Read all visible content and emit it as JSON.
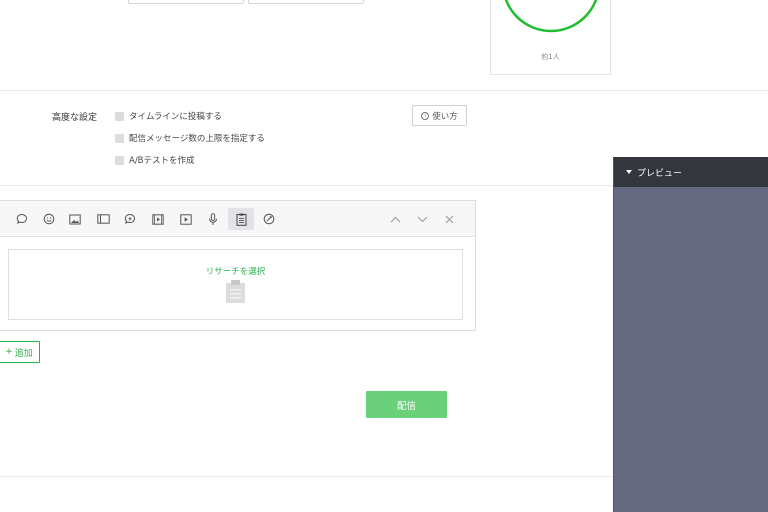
{
  "audience": {
    "percent_value": "100",
    "percent_unit": "%",
    "estimate": "約1人",
    "fill_fraction": 1.0,
    "ring_color": "#1fbd2f"
  },
  "advanced": {
    "label": "高度な設定",
    "options": [
      {
        "label": "タイムラインに投稿する",
        "checked": false
      },
      {
        "label": "配信メッセージ数の上限を指定する",
        "checked": false
      },
      {
        "label": "A/Bテストを作成",
        "checked": false
      }
    ],
    "help_label": "使い方",
    "help_icon": "info-icon"
  },
  "editor": {
    "toolbar_icons": [
      "speech-bubble-icon",
      "smiley-icon",
      "image-icon",
      "card-icon",
      "rich-message-icon",
      "rich-video-icon",
      "video-icon",
      "microphone-icon",
      "research-icon",
      "coupon-icon"
    ],
    "active_icon": "research-icon",
    "controls": [
      "move-up-icon",
      "move-down-icon",
      "close-icon"
    ],
    "research_link": "リサーチを選択"
  },
  "add_label": "追加",
  "send_label": "配信",
  "preview": {
    "title": "プレビュー"
  },
  "colors": {
    "accent_green": "#2db24a",
    "send_button": "#6ad17a",
    "preview_bg": "#656a80",
    "preview_header": "#33373d"
  }
}
